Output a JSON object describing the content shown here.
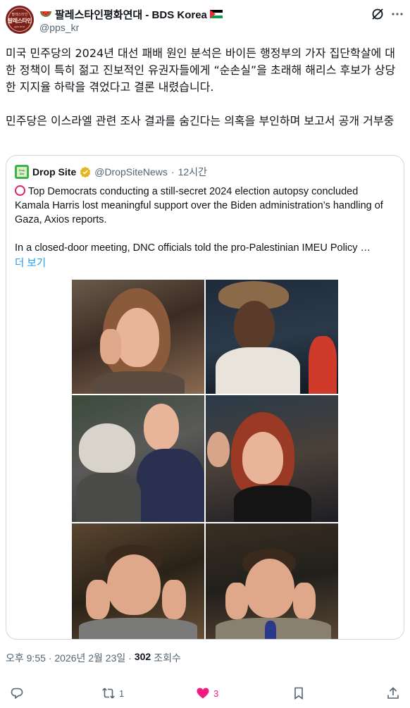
{
  "author": {
    "name": "팔레스타인평화연대 - BDS Korea",
    "handle": "@pps_kr",
    "avatar_text_small_top": "팔레스타인",
    "avatar_text_main": "팔레스타인",
    "avatar_text_small_bottom": "pps.or.kr"
  },
  "post": {
    "text": "미국 민주당의 2024년 대선 패배 원인 분석은 바이든 행정부의 가자 집단학살에 대한 정책이 특히 젊고 진보적인 유권자들에게 “순손실”을 초래해 해리스 후보가 상당한 지지율 하락을 겪었다고 결론 내렸습니다.\n\n민주당은 이스라엘 관련 조사 결과를 숨긴다는 의혹을 부인하며 보고서 공개 거부중"
  },
  "quote": {
    "avatar_text": "Drop Site",
    "name": "Drop Site",
    "handle": "@DropSiteNews",
    "separator": "·",
    "time": "12시간",
    "text_line1": "Top Democrats conducting a still-secret 2024 election autopsy concluded Kamala Harris lost meaningful support over the Biden administration’s handling of Gaza, Axios reports.",
    "text_line2": "In a closed-door meeting, DNC officials told the pro-Palestinian IMEU Policy …",
    "show_more": "더 보기"
  },
  "footer": {
    "timestamp": "오후 9:55 · 2026년 2월 23일 ·",
    "views_count": "302",
    "views_label": "조회수"
  },
  "actions": {
    "reply_count": "",
    "retweet_count": "1",
    "like_count": "3",
    "like_active_color": "#f91880"
  },
  "icons": [
    "watermelon-icon",
    "palestine-flag-icon",
    "grok-icon",
    "more-icon",
    "verified-badge-icon",
    "reply-icon",
    "retweet-icon",
    "like-icon",
    "bookmark-icon",
    "share-icon"
  ]
}
